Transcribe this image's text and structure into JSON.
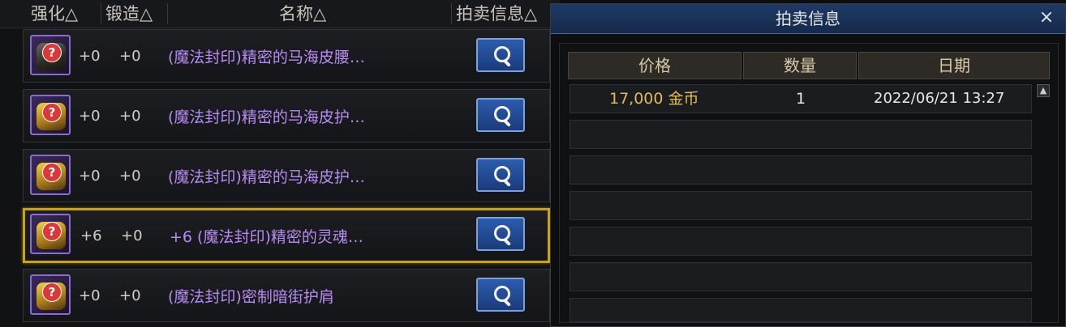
{
  "list": {
    "headers": {
      "enhance": "强化△",
      "forge": "锻造△",
      "name": "名称△",
      "auction": "拍卖信息△"
    },
    "items": [
      {
        "enhance": "+0",
        "forge": "+0",
        "name": "(魔法封印)精密的马海皮腰…",
        "icon": "belt-icon",
        "selected": false
      },
      {
        "enhance": "+0",
        "forge": "+0",
        "name": "(魔法封印)精密的马海皮护…",
        "icon": "armor-icon",
        "selected": false
      },
      {
        "enhance": "+0",
        "forge": "+0",
        "name": "(魔法封印)精密的马海皮护…",
        "icon": "armor-icon",
        "selected": false
      },
      {
        "enhance": "+6",
        "forge": "+0",
        "name": "+6 (魔法封印)精密的灵魂…",
        "icon": "armor-icon",
        "selected": true
      },
      {
        "enhance": "+0",
        "forge": "+0",
        "name": "(魔法封印)密制暗街护肩",
        "icon": "shoulder-icon",
        "selected": false
      }
    ]
  },
  "auction_dialog": {
    "title": "拍卖信息",
    "close_label": "×",
    "columns": {
      "price": "价格",
      "quantity": "数量",
      "date": "日期"
    },
    "rows": [
      {
        "price": "17,000 金币",
        "quantity": "1",
        "date": "2022/06/21 13:27"
      }
    ],
    "scroll_up": "▲"
  },
  "colors": {
    "item_name": "#b68bf2",
    "price": "#e2b95a",
    "selection": "#c9a11a"
  }
}
